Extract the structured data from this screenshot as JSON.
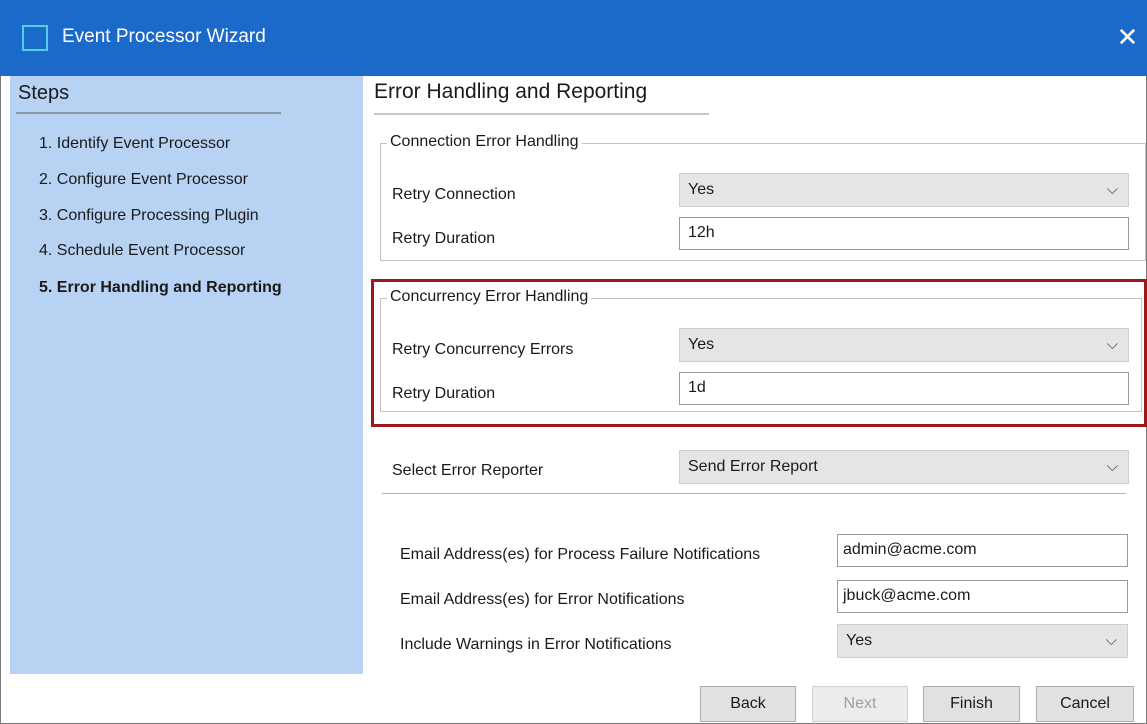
{
  "window": {
    "title": "Event Processor Wizard",
    "close_glyph": "✕"
  },
  "steps": {
    "title": "Steps",
    "items": [
      {
        "label": "1. Identify Event Processor"
      },
      {
        "label": "2. Configure Event Processor"
      },
      {
        "label": "3. Configure Processing Plugin"
      },
      {
        "label": "4. Schedule Event Processor"
      },
      {
        "label": "5. Error Handling and Reporting",
        "active": true
      }
    ]
  },
  "page": {
    "title": "Error Handling and Reporting",
    "connection": {
      "legend": "Connection Error Handling",
      "retry_label": "Retry Connection",
      "retry_value": "Yes",
      "duration_label": "Retry Duration",
      "duration_value": "12h"
    },
    "concurrency": {
      "legend": "Concurrency Error Handling",
      "retry_label": "Retry Concurrency Errors",
      "retry_value": "Yes",
      "duration_label": "Retry Duration",
      "duration_value": "1d"
    },
    "reporter": {
      "label": "Select Error Reporter",
      "value": "Send Error Report"
    },
    "notifications": {
      "failure_label": "Email Address(es) for Process Failure Notifications",
      "failure_value": "admin@acme.com",
      "error_label": "Email Address(es) for Error Notifications",
      "error_value": "jbuck@acme.com",
      "warnings_label": "Include Warnings in Error Notifications",
      "warnings_value": "Yes"
    }
  },
  "buttons": {
    "back": "Back",
    "next": "Next",
    "finish": "Finish",
    "cancel": "Cancel"
  },
  "colors": {
    "titlebar": "#1b6ac9",
    "steps_panel": "#b7d2f2",
    "highlight": "#9b1b1b"
  },
  "icons": {
    "chevron": "chevron-down-icon",
    "close": "close-icon",
    "app": "app-icon"
  }
}
